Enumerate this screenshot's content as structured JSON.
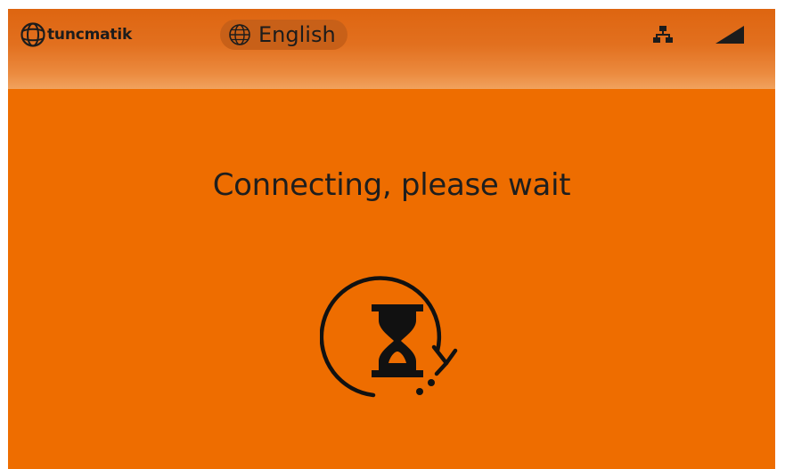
{
  "header": {
    "logo": {
      "icon": "globe-logo-icon",
      "text": "tuncmatik"
    },
    "language": {
      "icon": "globe-icon",
      "label": "English"
    },
    "status_icons": [
      "network-icon",
      "signal-icon"
    ]
  },
  "main": {
    "message": "Connecting, please wait",
    "spinner_icon": "hourglass-loading-icon"
  },
  "colors": {
    "background": "#ee6d00",
    "header_gradient_top": "#de6510",
    "header_gradient_bottom": "#f1a25e",
    "language_pill": "#c86018",
    "foreground": "#1c1c1c"
  }
}
